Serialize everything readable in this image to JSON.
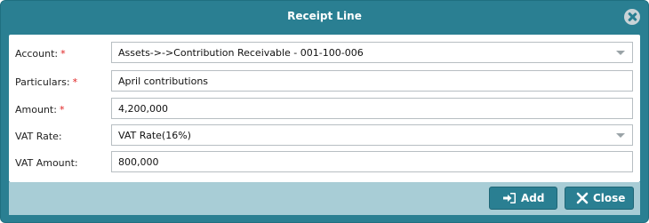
{
  "dialog": {
    "title": "Receipt Line",
    "close_icon": "close-circle-icon"
  },
  "form": {
    "account": {
      "label": "Account:",
      "required_mark": "*",
      "value": "Assets->->Contribution Receivable - 001-100-006"
    },
    "particulars": {
      "label": "Particulars:",
      "required_mark": "*",
      "value": "April contributions"
    },
    "amount": {
      "label": "Amount:",
      "required_mark": "*",
      "value": "4,200,000"
    },
    "vat_rate": {
      "label": "VAT Rate:",
      "value": "VAT Rate(16%)"
    },
    "vat_amount": {
      "label": "VAT Amount:",
      "value": "800,000"
    }
  },
  "footer": {
    "add_label": "Add",
    "add_icon": "sign-in-icon",
    "close_label": "Close",
    "close_icon": "close-icon"
  },
  "colors": {
    "header": "#2a7f92",
    "footer": "#a8cdd6",
    "required": "#e02020"
  }
}
